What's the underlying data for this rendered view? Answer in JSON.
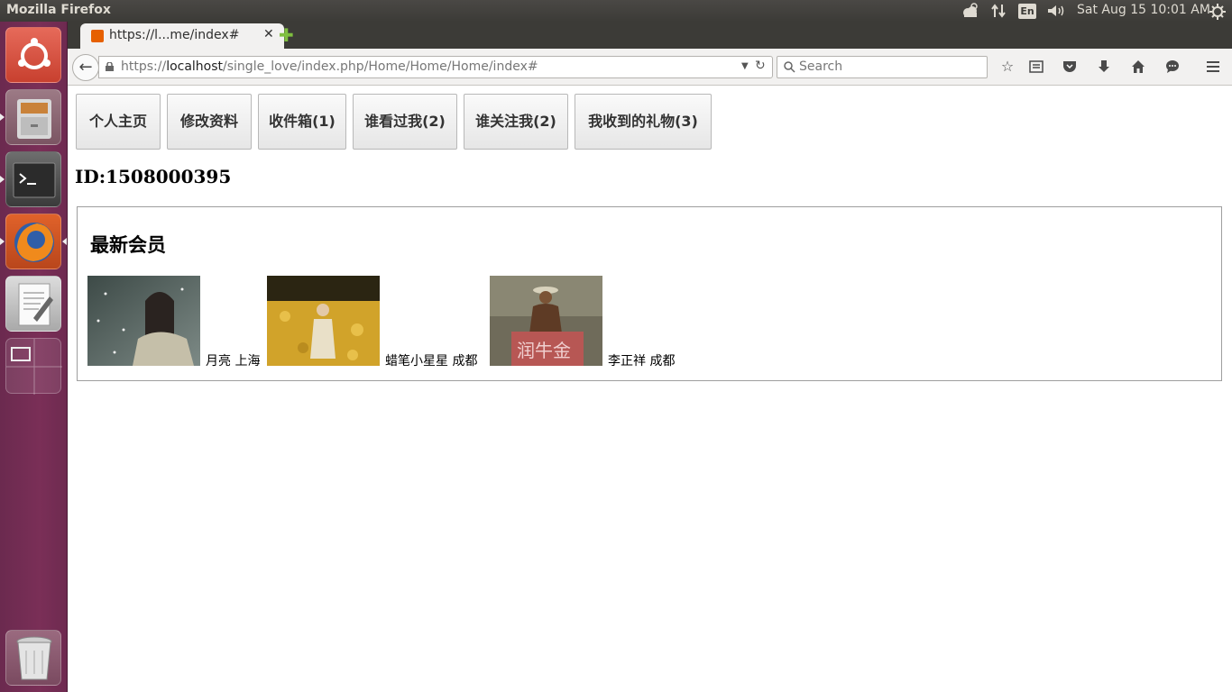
{
  "system": {
    "app_title": "Mozilla Firefox",
    "keyboard_layout": "En",
    "clock": "Sat Aug 15 10:01 AM"
  },
  "browser": {
    "tab_title": "https://l...me/index#",
    "url_scheme": "https://",
    "url_host": "localhost",
    "url_path": "/single_love/index.php/Home/Home/Home/index#",
    "search_placeholder": "Search"
  },
  "page": {
    "nav_buttons": [
      {
        "label": "个人主页"
      },
      {
        "label": "修改资料"
      },
      {
        "label": "收件箱(1)"
      },
      {
        "label": "谁看过我(2)"
      },
      {
        "label": "谁关注我(2)"
      },
      {
        "label": "我收到的礼物(3)"
      }
    ],
    "user_id": "ID:1508000395",
    "members_section": {
      "title": "最新会员",
      "members": [
        {
          "name_city": "月亮 上海"
        },
        {
          "name_city": "蜡笔小星星 成都"
        },
        {
          "name_city": "李正祥 成都"
        }
      ]
    }
  }
}
